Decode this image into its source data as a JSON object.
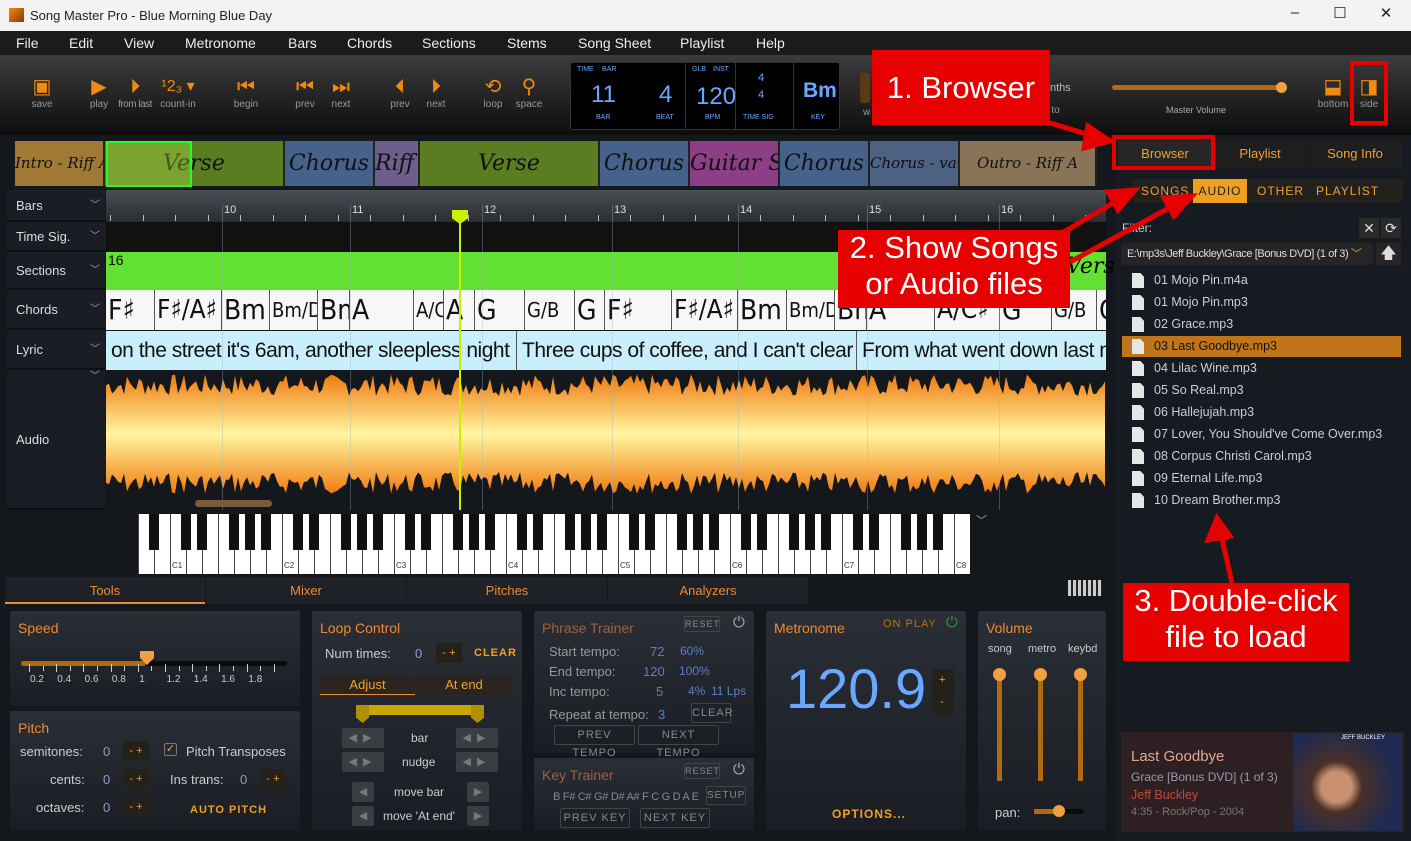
{
  "window": {
    "title": "Song Master Pro - Blue Morning Blue Day",
    "controls": [
      "–",
      "☐",
      "✕"
    ]
  },
  "menu": [
    "File",
    "Edit",
    "View",
    "Metronome",
    "Bars",
    "Chords",
    "Sections",
    "Stems",
    "Song Sheet",
    "Playlist",
    "Help"
  ],
  "toolbar": {
    "buttons": [
      {
        "icon": "save-icon",
        "label": "save"
      },
      {
        "icon": "play-icon",
        "label": "play"
      },
      {
        "icon": "play-from-last-icon",
        "label": "from last"
      },
      {
        "icon": "count-in-icon",
        "label": "count-in",
        "glyph": "¹2₃ ▾"
      },
      {
        "icon": "begin-icon",
        "label": "begin"
      },
      {
        "icon": "prev-bar-icon",
        "label": "prev"
      },
      {
        "icon": "next-bar-icon",
        "label": "next"
      },
      {
        "icon": "prev-section-icon",
        "label": "prev"
      },
      {
        "icon": "next-section-icon",
        "label": "next"
      },
      {
        "icon": "loop-icon",
        "label": "loop"
      },
      {
        "icon": "space-icon",
        "label": "space"
      }
    ],
    "lcd": {
      "time_label": "TIME",
      "bar_label_top": "BAR",
      "glb": "GLB",
      "inst": "INST",
      "bar": "11",
      "beat": "4",
      "bpm": "120",
      "ts_num": "4",
      "ts_den": "4",
      "key": "Bm",
      "bar_label": "BAR",
      "beat_label": "BEAT",
      "bpm_label": "BPM",
      "timesig_label": "TIME SIG",
      "key_label": "KEY"
    },
    "partial_w": "w",
    "partial_nths": "nths",
    "partial_pto": "p to",
    "master_volume_label": "Master Volume",
    "master_volume": 0.95,
    "layout_bottom": "bottom",
    "layout_side": "side"
  },
  "sections_strip": [
    {
      "name": "Intro - Riff A",
      "color": "#a07a35"
    },
    {
      "name": "Verse",
      "color": "#5a7d22"
    },
    {
      "name": "Chorus",
      "color": "#46618a"
    },
    {
      "name": "Riff A",
      "color": "#6d5e8c"
    },
    {
      "name": "Verse",
      "color": "#5a7d22"
    },
    {
      "name": "Chorus",
      "color": "#46618a"
    },
    {
      "name": "Guitar Solo",
      "color": "#8c3f86"
    },
    {
      "name": "Chorus",
      "color": "#46618a"
    },
    {
      "name": "Chorus - variation",
      "color": "#4d6182"
    },
    {
      "name": "Outro - Riff A",
      "color": "#8a7458"
    }
  ],
  "tracks": [
    "Bars",
    "Time Sig.",
    "Sections",
    "Chords",
    "Lyric",
    "Audio"
  ],
  "ruler": [
    "10",
    "11",
    "12",
    "13",
    "14",
    "15",
    "16"
  ],
  "section_row": {
    "count": "16",
    "next": "Vers"
  },
  "chords": [
    "F♯",
    "F♯/A♯",
    "Bm",
    "Bm/D",
    "Bm",
    "A",
    "A/C♯",
    "A",
    "G",
    "G/B",
    "G",
    "F♯",
    "F♯/A♯",
    "Bm",
    "Bm/D",
    "Bm",
    "A",
    "A/C♯",
    "G",
    "G/B",
    "G"
  ],
  "lyrics": [
    "on the street it's 6am, another sleepless night",
    "Three cups of coffee, and I can't clear my head",
    "From what went down last night"
  ],
  "piano_labels": [
    "C1",
    "C2",
    "C3",
    "C4",
    "C5",
    "C6",
    "C7",
    "C8"
  ],
  "bottom_tabs": [
    "Tools",
    "Mixer",
    "Pitches",
    "Analyzers"
  ],
  "speed": {
    "title": "Speed",
    "ticks": [
      "0.2",
      "0.4",
      "0.6",
      "0.8",
      "1",
      "1.2",
      "1.4",
      "1.6",
      "1.8"
    ],
    "value": 1.0
  },
  "pitch": {
    "title": "Pitch",
    "semitones_label": "semitones:",
    "semitones": "0",
    "cents_label": "cents:",
    "cents": "0",
    "octaves_label": "octaves:",
    "octaves": "0",
    "pitch_transposes": "Pitch Transposes",
    "pitch_transposes_checked": true,
    "ins_trans_label": "Ins trans:",
    "ins_trans": "0",
    "auto_pitch": "AUTO PITCH"
  },
  "loop": {
    "title": "Loop Control",
    "num_times_label": "Num times:",
    "num_times": "0",
    "clear": "CLEAR",
    "tab_adjust": "Adjust",
    "tab_at_end": "At end",
    "bar": "bar",
    "nudge": "nudge",
    "move_bar": "move bar",
    "move_at_end": "move 'At end'"
  },
  "phrase": {
    "title": "Phrase Trainer",
    "reset": "RESET",
    "start_label": "Start tempo:",
    "start": "72",
    "start_pct": "60%",
    "end_label": "End tempo:",
    "end": "120",
    "end_pct": "100%",
    "inc_label": "Inc tempo:",
    "inc": "5",
    "inc_pct": "4%",
    "lps": "11 Lps",
    "repeat_label": "Repeat at tempo:",
    "repeat": "3",
    "clear": "CLEAR",
    "prev": "PREV TEMPO",
    "next": "NEXT TEMPO"
  },
  "key_trainer": {
    "title": "Key Trainer",
    "reset": "RESET",
    "keys": "B F# C# G# D# A# F C G D A E",
    "setup": "SETUP",
    "prev": "PREV KEY",
    "next": "NEXT KEY"
  },
  "metronome": {
    "title": "Metronome",
    "on_play": "ON PLAY",
    "tempo": "120.9",
    "plus": "+",
    "minus": "-",
    "options": "OPTIONS..."
  },
  "volume": {
    "title": "Volume",
    "song": "song",
    "metro": "metro",
    "keybd": "keybd",
    "pan_label": "pan:",
    "levels": {
      "song": 1.0,
      "metro": 1.0,
      "keybd": 1.0
    },
    "pan": 0.5
  },
  "side": {
    "tabs": [
      "Browser",
      "Playlist",
      "Song Info"
    ],
    "subtabs": [
      "SONGS",
      "AUDIO",
      "OTHER",
      "PLAYLIST"
    ],
    "active_subtab": "AUDIO",
    "filter_label": "Filter:",
    "path": "E:\\mp3s\\Jeff Buckley\\Grace [Bonus DVD] (1 of 3)",
    "files": [
      "01 Mojo Pin.m4a",
      "01 Mojo Pin.mp3",
      "02 Grace.mp3",
      "03 Last Goodbye.mp3",
      "04 Lilac Wine.mp3",
      "05 So Real.mp3",
      "06 Hallejujah.mp3",
      "07 Lover, You Should've Come Over.mp3",
      "08 Corpus Christi Carol.mp3",
      "09 Eternal Life.mp3",
      "10 Dream Brother.mp3"
    ],
    "selected_file": "03 Last Goodbye.mp3",
    "now_playing": {
      "title": "Last Goodbye",
      "album": "Grace [Bonus DVD] (1 of 3)",
      "artist": "Jeff Buckley",
      "info": "4:35 - Rock/Pop - 2004",
      "cover_text": "JEFF BUCKLEY"
    }
  },
  "annotations": [
    "1. Browser",
    "2. Show Songs or Audio files",
    "3. Double-click file to load"
  ],
  "colors": {
    "accent": "#f08a10",
    "annotation": "#e60000",
    "lcd": "#6aa8ff",
    "section_green": "#63e133",
    "lyric_bg": "#c9eefc",
    "selected": "#c0751b"
  }
}
